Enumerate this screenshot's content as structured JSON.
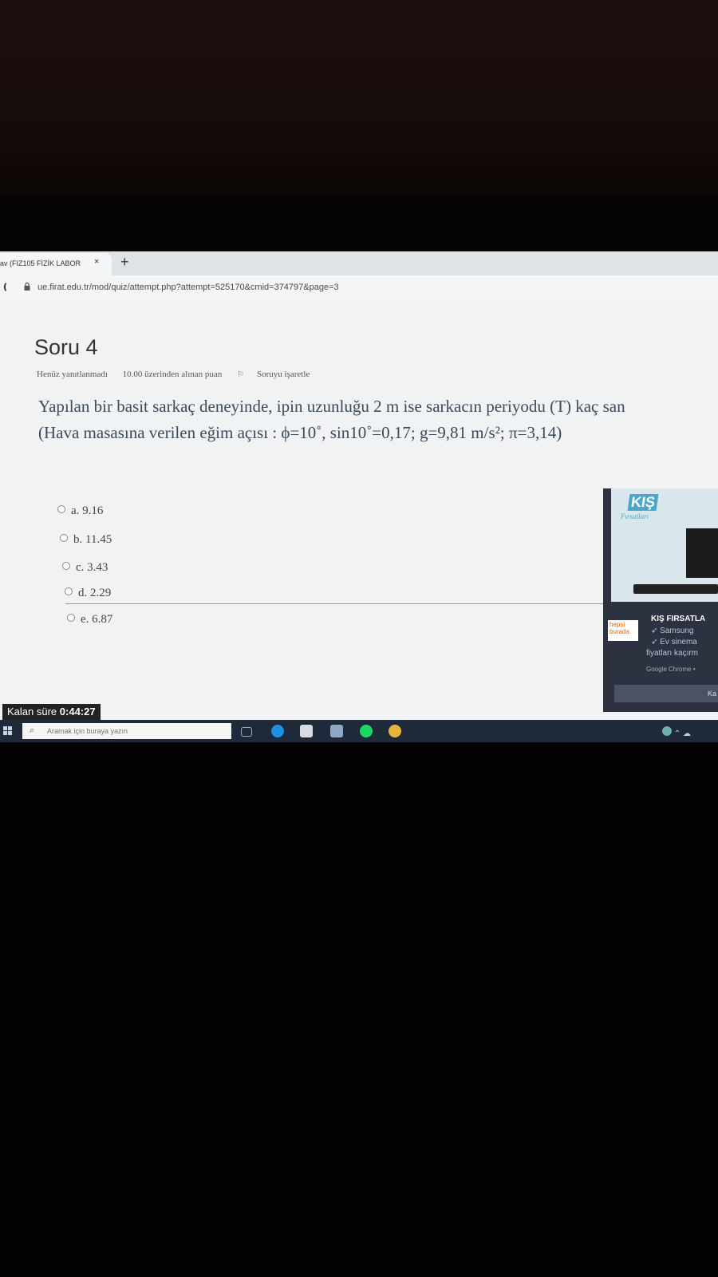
{
  "browser": {
    "tab_title": "av (FIZ105 FİZİK LABOR",
    "tab_close": "×",
    "new_tab": "+",
    "url": "ue.firat.edu.tr/mod/quiz/attempt.php?attempt=525170&cmid=374797&page=3"
  },
  "question": {
    "title": "Soru 4",
    "status": "Henüz yanıtlanmadı",
    "points": "10.00 üzerinden alınan puan",
    "flag_label": "Soruyu işaretle",
    "text_line1": "Yapılan bir basit sarkaç deneyinde, ipin uzunluğu 2 m ise sarkacın periyodu (T) kaç san",
    "text_line2": "(Hava masasına verilen eğim açısı : ϕ=10˚, sin10˚=0,17; g=9,81 m/s²; π=3,14)",
    "answers": [
      {
        "label": "a. 9.16"
      },
      {
        "label": "b. 11.45"
      },
      {
        "label": "c. 3.43"
      },
      {
        "label": "d. 2.29"
      },
      {
        "label": "e. 6.87"
      }
    ]
  },
  "ad": {
    "logo": "KIŞ",
    "logo_sub": "Fırsatları",
    "brand_line1": "hepsi",
    "brand_line2": "burada",
    "headline": "KIŞ FIRSATLA",
    "line1": "Samsung",
    "line2": "Ev sinema",
    "line3": "fiyatları kaçırm",
    "source": "Google Chrome •",
    "button": "Ka"
  },
  "timer": {
    "label": "Kalan süre",
    "value": "0:44:27"
  },
  "taskbar": {
    "search_placeholder": "Aramak için buraya yazın"
  }
}
